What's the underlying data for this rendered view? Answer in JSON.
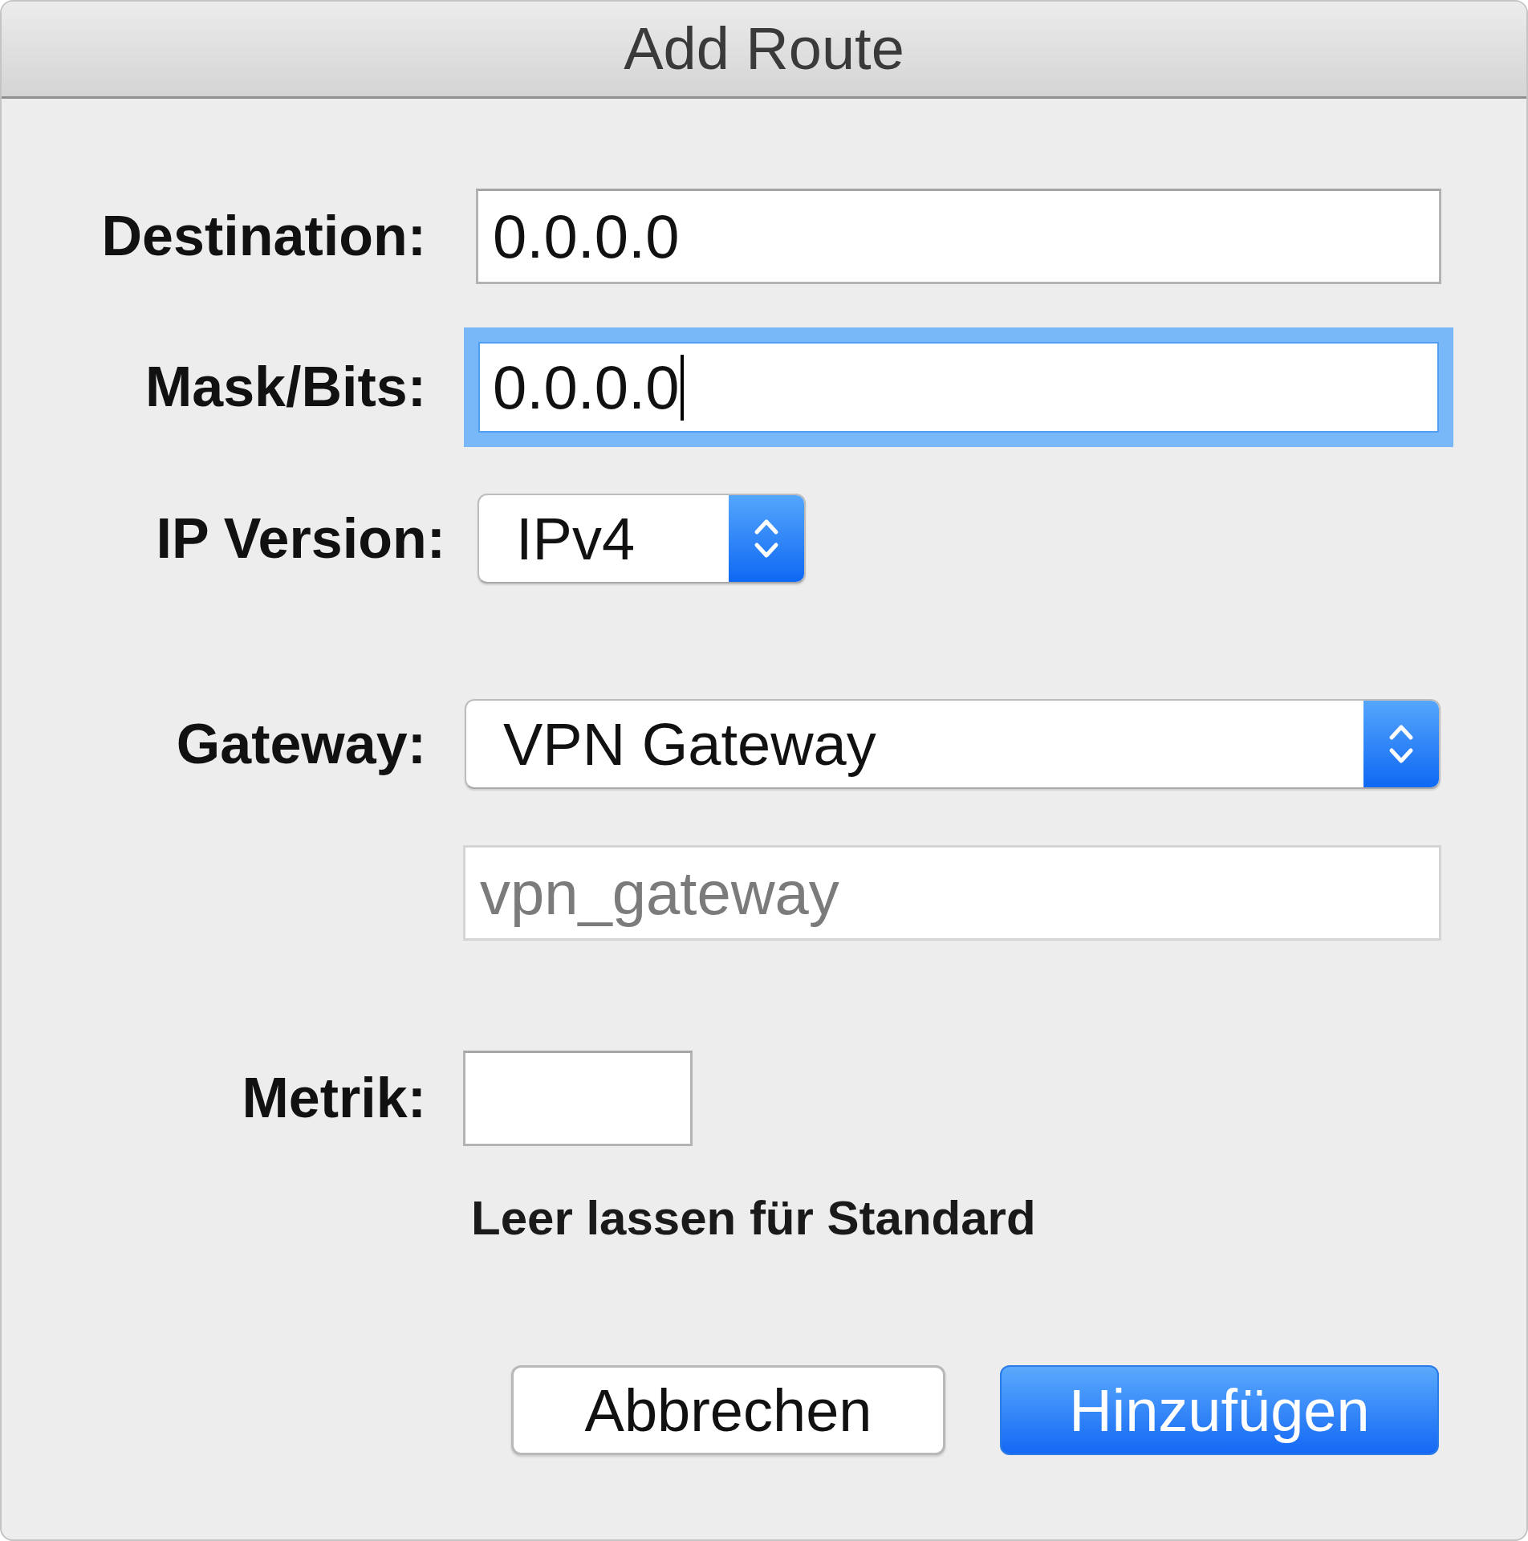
{
  "window": {
    "title": "Add Route"
  },
  "destination": {
    "label": "Destination:",
    "value": "0.0.0.0",
    "focused": false,
    "disabled": false
  },
  "mask": {
    "label": "Mask/Bits:",
    "value": "0.0.0.0",
    "focused": true,
    "disabled": false
  },
  "ip_version": {
    "label": "IP Version:",
    "value": "IPv4"
  },
  "gateway": {
    "label": "Gateway:",
    "value": "VPN Gateway"
  },
  "gateway_address": {
    "value": "vpn_gateway",
    "focused": false,
    "disabled": true
  },
  "metric": {
    "label": "Metrik:",
    "focused": false,
    "disabled": false,
    "hint": "Leer lassen für Standard"
  },
  "buttons": [
    {
      "label": "Abbrechen",
      "default": false
    },
    {
      "label": "Hinzufügen",
      "default": true
    }
  ]
}
